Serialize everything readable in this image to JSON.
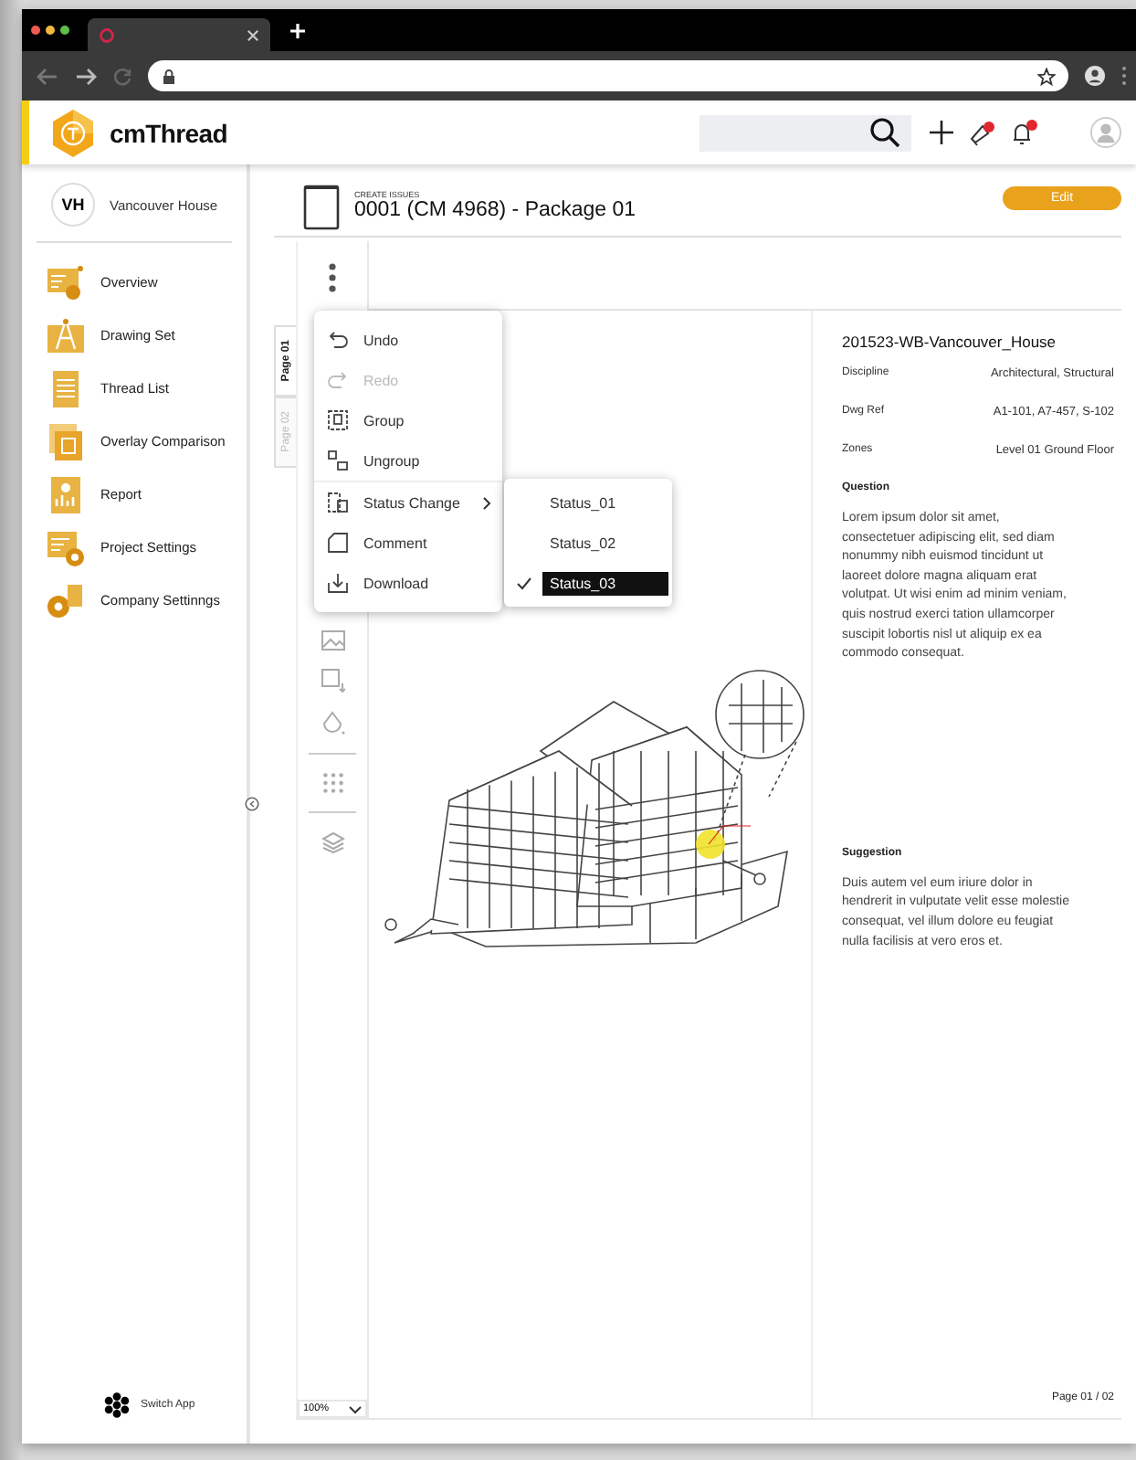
{
  "app": {
    "brand": "cmThread"
  },
  "project": {
    "initials": "VH",
    "name": "Vancouver House"
  },
  "sidebar": {
    "items": [
      {
        "label": "Overview"
      },
      {
        "label": "Drawing Set"
      },
      {
        "label": "Thread List"
      },
      {
        "label": "Overlay Comparison"
      },
      {
        "label": "Report"
      },
      {
        "label": "Project Settings"
      },
      {
        "label": "Company Settinngs"
      }
    ],
    "switch_app": "Switch App"
  },
  "issue": {
    "eyebrow": "CREATE ISSUES",
    "title": "0001 (CM 4968) - Package 01",
    "edit_button": "Edit"
  },
  "page_tabs": [
    {
      "label": "Page 01",
      "selected": true
    },
    {
      "label": "Page 02",
      "selected": false
    }
  ],
  "context_menu": {
    "items": [
      {
        "label": "Undo",
        "disabled": false,
        "submenu": false
      },
      {
        "label": "Redo",
        "disabled": true,
        "submenu": false
      },
      {
        "label": "Group",
        "disabled": false,
        "submenu": false
      },
      {
        "label": "Ungroup",
        "disabled": false,
        "submenu": false
      },
      {
        "label": "Status Change",
        "disabled": false,
        "submenu": true
      },
      {
        "label": "Comment",
        "disabled": false,
        "submenu": false
      },
      {
        "label": "Download",
        "disabled": false,
        "submenu": false
      }
    ]
  },
  "status_submenu": [
    {
      "label": "Status_01",
      "selected": false
    },
    {
      "label": "Status_02",
      "selected": false
    },
    {
      "label": "Status_03",
      "selected": true
    }
  ],
  "zoom_select": {
    "value": "100%"
  },
  "details": {
    "drawing_title": "201523-WB-Vancouver_House",
    "fields": [
      {
        "label": "Discipline",
        "value": "Architectural, Structural"
      },
      {
        "label": "Dwg Ref",
        "value": "A1-101, A7-457, S-102"
      },
      {
        "label": "Zones",
        "value": "Level 01 Ground Floor"
      }
    ],
    "question_label": "Question",
    "question": "Lorem ipsum dolor sit amet, consectetuer adipiscing elit, sed diam nonummy nibh euismod tincidunt ut laoreet dolore magna aliquam erat volutpat. Ut wisi enim ad minim veniam, quis nostrud exerci tation ullamcorper suscipit lobortis nisl ut aliquip ex ea commodo consequat.",
    "suggestion_label": "Suggestion",
    "suggestion": "Duis autem vel eum iriure dolor in hendrerit in vulputate velit esse molestie consequat, vel illum dolore eu feugiat nulla facilisis at vero eros et."
  },
  "page_indicator": "Page 01 / 02"
}
